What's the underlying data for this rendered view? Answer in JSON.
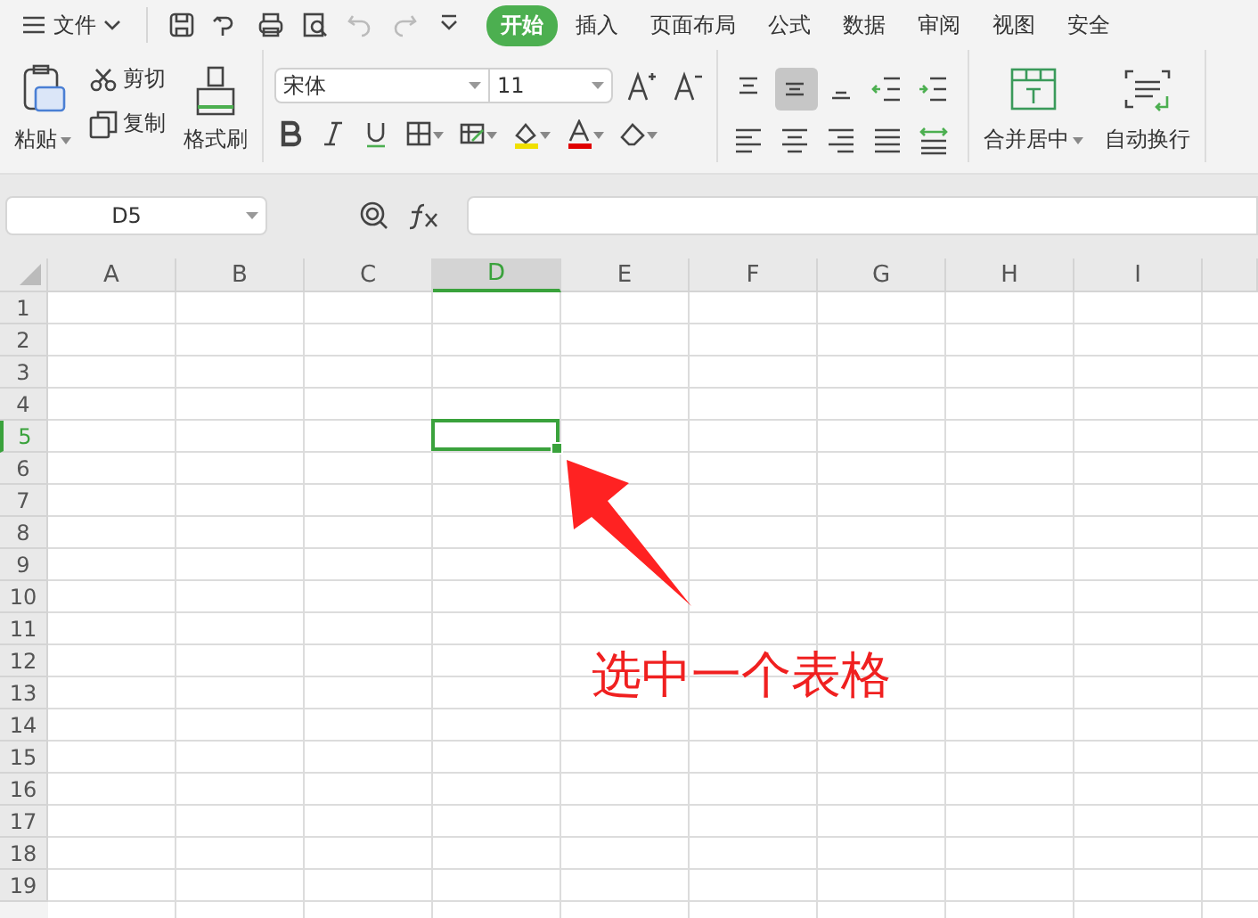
{
  "menu": {
    "label": "文件"
  },
  "tabs": [
    {
      "label": "开始",
      "selected": true
    },
    {
      "label": "插入",
      "selected": false
    },
    {
      "label": "页面布局",
      "selected": false
    },
    {
      "label": "公式",
      "selected": false
    },
    {
      "label": "数据",
      "selected": false
    },
    {
      "label": "审阅",
      "selected": false
    },
    {
      "label": "视图",
      "selected": false
    },
    {
      "label": "安全",
      "selected": false
    }
  ],
  "clipboard": {
    "paste": "粘贴",
    "cut": "剪切",
    "copy": "复制",
    "format_painter": "格式刷"
  },
  "font": {
    "family": "宋体",
    "size": "11"
  },
  "align_buttons": [
    {
      "kind": "top",
      "selected": false
    },
    {
      "kind": "middle",
      "selected": true
    },
    {
      "kind": "bottom",
      "selected": false
    },
    {
      "kind": "outdent",
      "selected": false
    },
    {
      "kind": "indent",
      "selected": false
    },
    {
      "kind": "left",
      "selected": false
    },
    {
      "kind": "center",
      "selected": false
    },
    {
      "kind": "right",
      "selected": false
    },
    {
      "kind": "justify",
      "selected": false
    },
    {
      "kind": "distributed",
      "selected": false
    }
  ],
  "merge": {
    "label": "合并居中"
  },
  "wrap": {
    "label": "自动换行"
  },
  "name_box": {
    "value": "D5"
  },
  "sheet": {
    "columns": [
      {
        "label": "A",
        "selected": false
      },
      {
        "label": "B",
        "selected": false
      },
      {
        "label": "C",
        "selected": false
      },
      {
        "label": "D",
        "selected": true
      },
      {
        "label": "E",
        "selected": false
      },
      {
        "label": "F",
        "selected": false
      },
      {
        "label": "G",
        "selected": false
      },
      {
        "label": "H",
        "selected": false
      },
      {
        "label": "I",
        "selected": false
      }
    ],
    "rows": [
      {
        "label": "1",
        "selected": false
      },
      {
        "label": "2",
        "selected": false
      },
      {
        "label": "3",
        "selected": false
      },
      {
        "label": "4",
        "selected": false
      },
      {
        "label": "5",
        "selected": true
      },
      {
        "label": "6",
        "selected": false
      },
      {
        "label": "7",
        "selected": false
      },
      {
        "label": "8",
        "selected": false
      },
      {
        "label": "9",
        "selected": false
      },
      {
        "label": "10",
        "selected": false
      },
      {
        "label": "11",
        "selected": false
      },
      {
        "label": "12",
        "selected": false
      },
      {
        "label": "13",
        "selected": false
      },
      {
        "label": "14",
        "selected": false
      },
      {
        "label": "15",
        "selected": false
      },
      {
        "label": "16",
        "selected": false
      },
      {
        "label": "17",
        "selected": false
      },
      {
        "label": "18",
        "selected": false
      },
      {
        "label": "19",
        "selected": false
      }
    ]
  },
  "annotation": {
    "text": "选中一个表格"
  }
}
